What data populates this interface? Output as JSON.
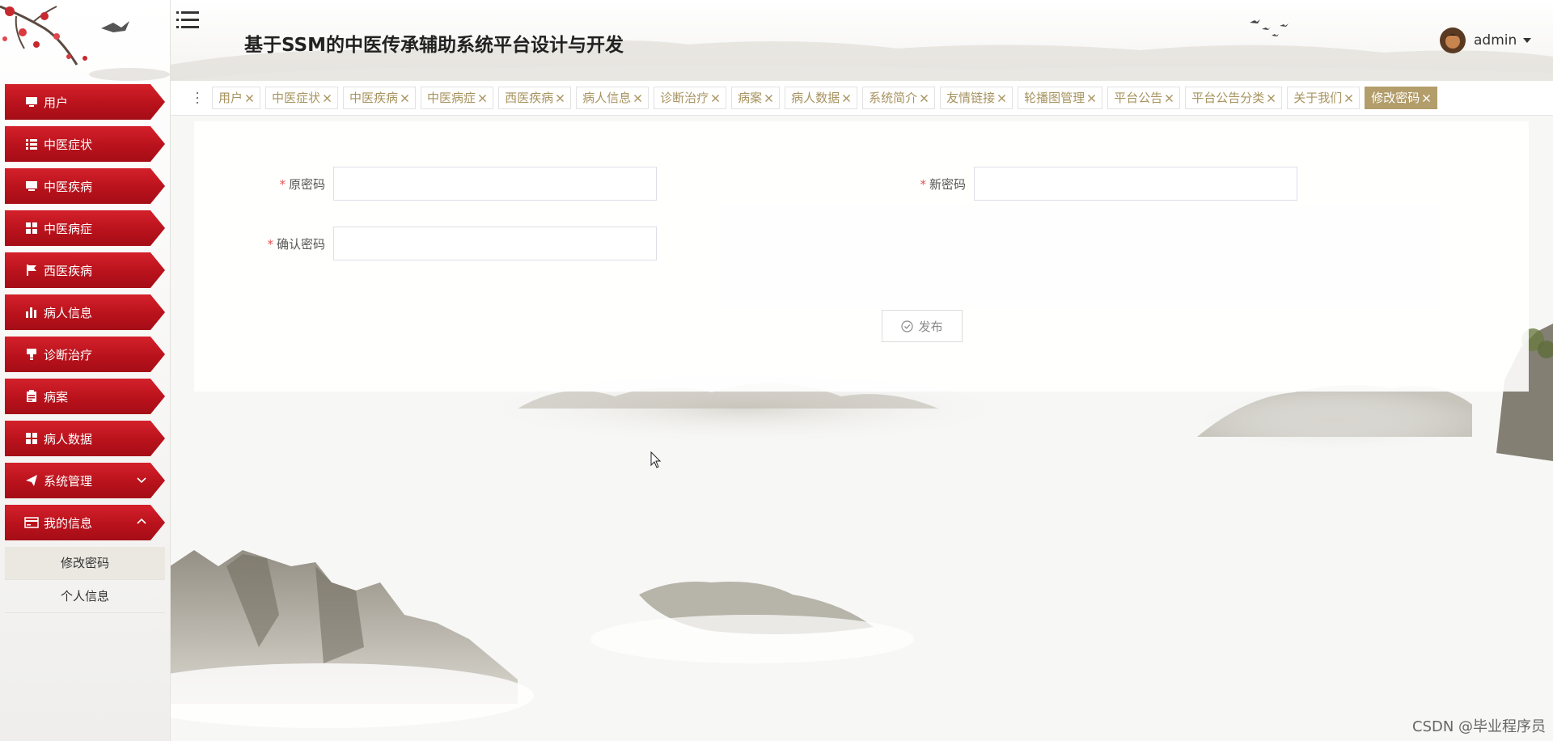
{
  "header": {
    "title": "基于SSM的中医传承辅助系统平台设计与开发",
    "user_name": "admin"
  },
  "sidebar": {
    "items": [
      {
        "label": "用户",
        "icon": "monitor-icon"
      },
      {
        "label": "中医症状",
        "icon": "list-icon"
      },
      {
        "label": "中医疾病",
        "icon": "desktop-icon"
      },
      {
        "label": "中医病症",
        "icon": "grid-icon"
      },
      {
        "label": "西医疾病",
        "icon": "flag-icon"
      },
      {
        "label": "病人信息",
        "icon": "bar-chart-icon"
      },
      {
        "label": "诊断治疗",
        "icon": "stamp-icon"
      },
      {
        "label": "病案",
        "icon": "clipboard-icon"
      },
      {
        "label": "病人数据",
        "icon": "grid-icon"
      },
      {
        "label": "系统管理",
        "icon": "paper-plane-icon",
        "expandable": true,
        "expanded": false
      },
      {
        "label": "我的信息",
        "icon": "id-card-icon",
        "expandable": true,
        "expanded": true
      }
    ],
    "submenu": [
      {
        "label": "修改密码",
        "active": true
      },
      {
        "label": "个人信息",
        "active": false
      }
    ]
  },
  "tabs": [
    {
      "label": "用户",
      "active": false
    },
    {
      "label": "中医症状",
      "active": false
    },
    {
      "label": "中医疾病",
      "active": false
    },
    {
      "label": "中医病症",
      "active": false
    },
    {
      "label": "西医疾病",
      "active": false
    },
    {
      "label": "病人信息",
      "active": false
    },
    {
      "label": "诊断治疗",
      "active": false
    },
    {
      "label": "病案",
      "active": false
    },
    {
      "label": "病人数据",
      "active": false
    },
    {
      "label": "系统简介",
      "active": false
    },
    {
      "label": "友情链接",
      "active": false
    },
    {
      "label": "轮播图管理",
      "active": false
    },
    {
      "label": "平台公告",
      "active": false
    },
    {
      "label": "平台公告分类",
      "active": false
    },
    {
      "label": "关于我们",
      "active": false
    },
    {
      "label": "修改密码",
      "active": true
    }
  ],
  "form": {
    "required_mark": "*",
    "old_password": {
      "label": "原密码",
      "value": "",
      "placeholder": ""
    },
    "new_password": {
      "label": "新密码",
      "value": "",
      "placeholder": ""
    },
    "confirm_password": {
      "label": "确认密码",
      "value": "",
      "placeholder": ""
    },
    "submit_label": "发布"
  },
  "watermark": "CSDN @毕业程序员",
  "colors": {
    "menu_red": "#b9121c",
    "tab_text": "#a7935f",
    "tab_active_bg": "#b29d6b",
    "required": "#e35454"
  }
}
